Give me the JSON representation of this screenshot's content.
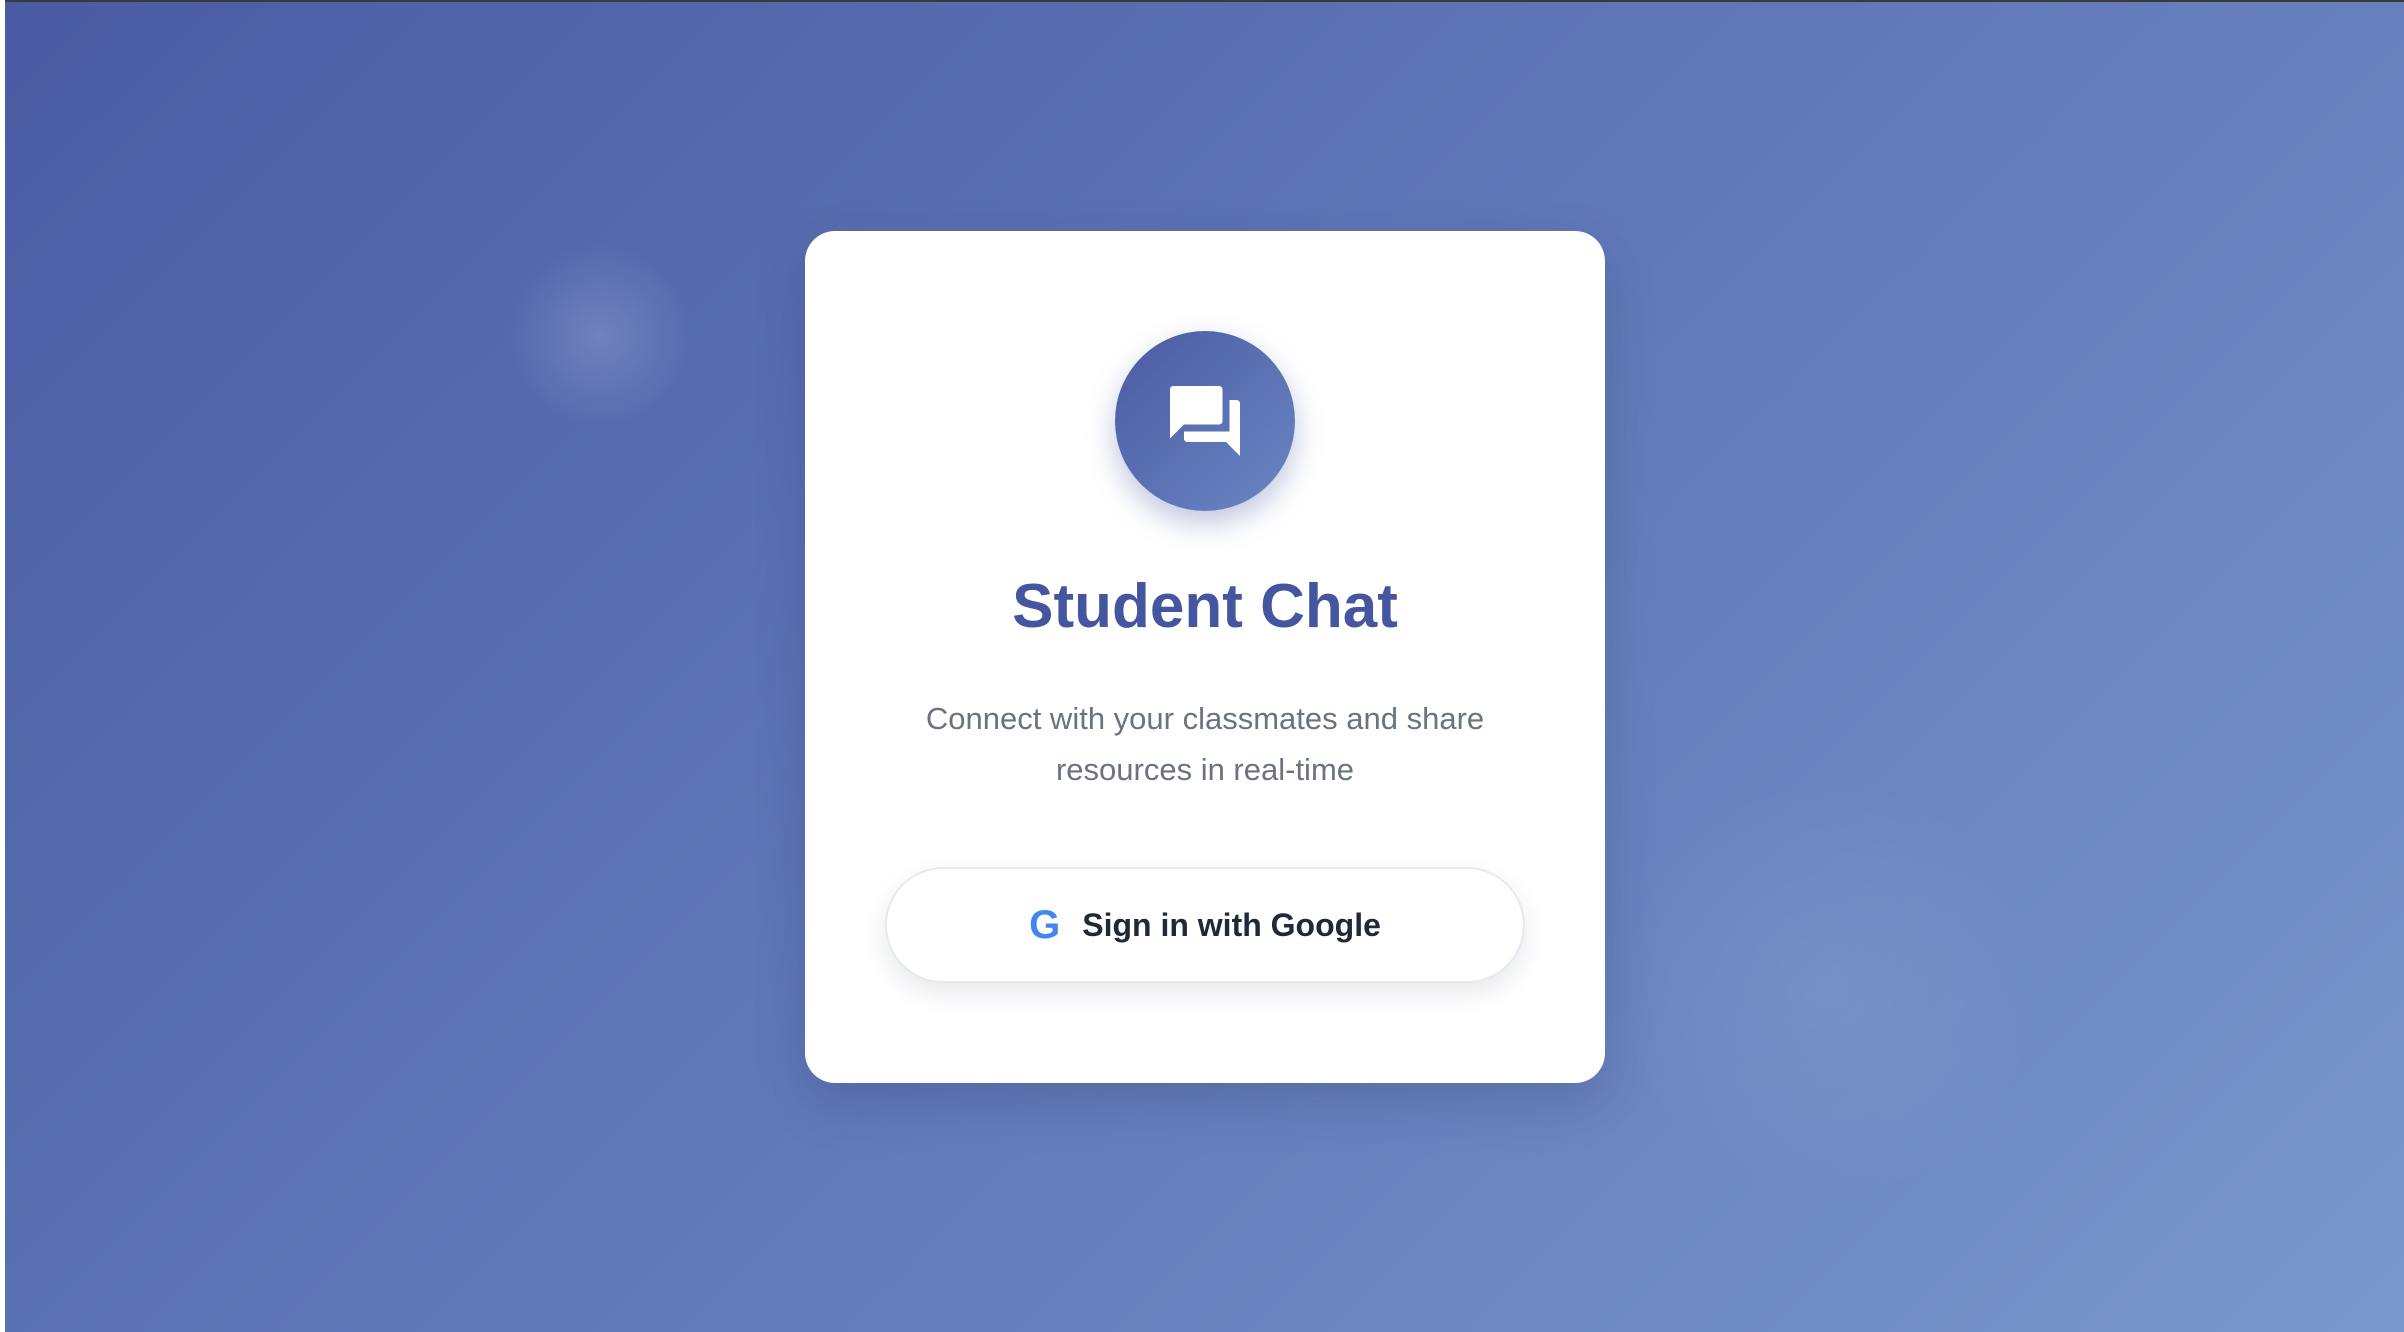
{
  "app": {
    "title": "Student Chat",
    "subtitle": "Connect with your classmates and share resources in real-time"
  },
  "logo": {
    "icon": "chat-bubbles-icon"
  },
  "signin": {
    "label": "Sign in with Google",
    "icon_glyph": "G",
    "icon": "google-icon"
  },
  "colors": {
    "background_start": "#4a5ba3",
    "background_end": "#7a98cc",
    "title": "#4555a0",
    "subtitle": "#6b7280",
    "google_blue": "#4285f4",
    "button_text": "#1f2937"
  }
}
